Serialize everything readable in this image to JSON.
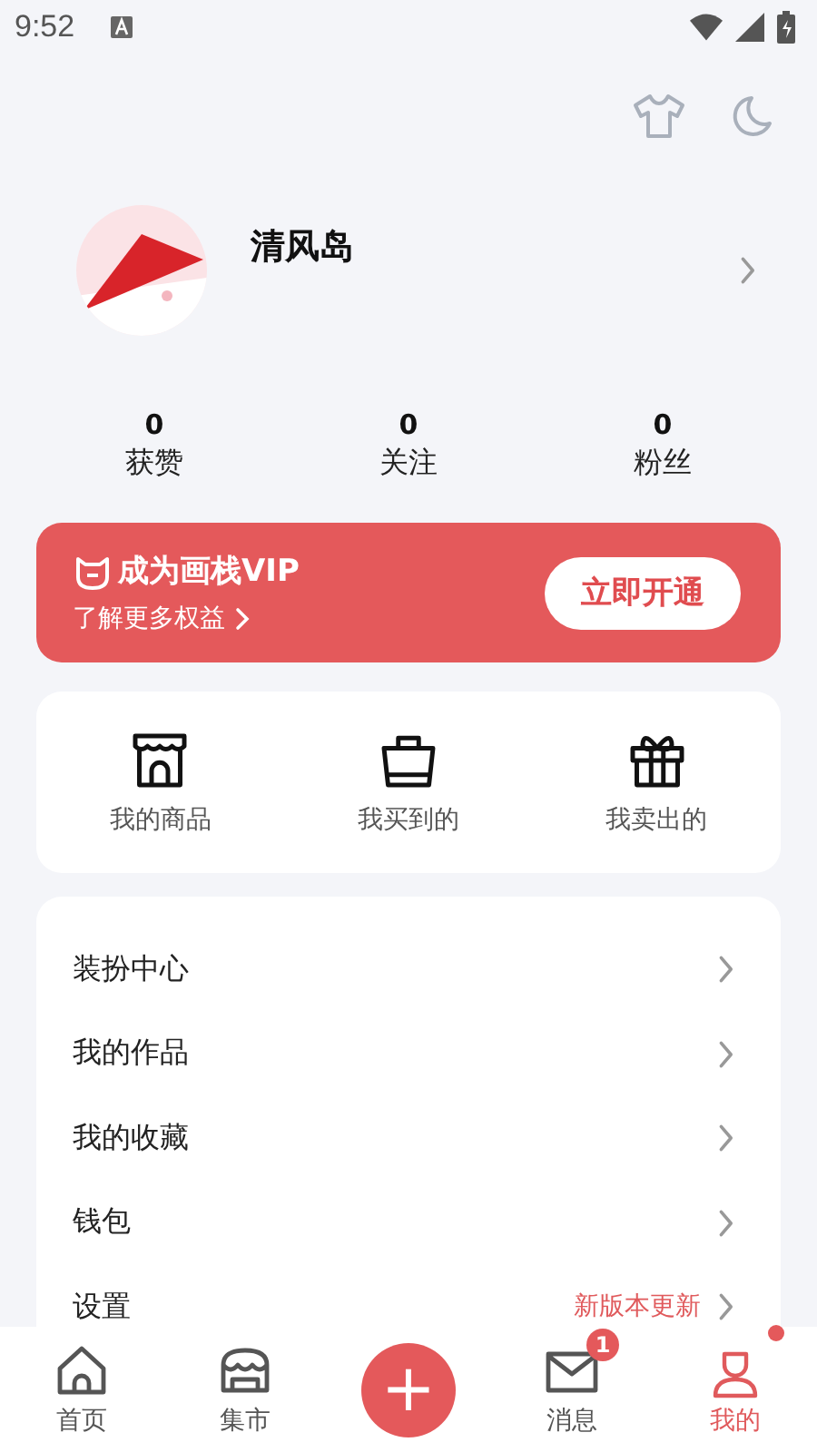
{
  "status_bar": {
    "time": "9:52"
  },
  "profile": {
    "name": "清风岛"
  },
  "stats": [
    {
      "value": "0",
      "label": "获赞"
    },
    {
      "value": "0",
      "label": "关注"
    },
    {
      "value": "0",
      "label": "粉丝"
    }
  ],
  "vip": {
    "title": "成为画栈VIP",
    "subtitle": "了解更多权益",
    "button": "立即开通"
  },
  "shortcuts": [
    {
      "label": "我的商品"
    },
    {
      "label": "我买到的"
    },
    {
      "label": "我卖出的"
    }
  ],
  "menu": [
    {
      "label": "装扮中心"
    },
    {
      "label": "我的作品"
    },
    {
      "label": "我的收藏"
    },
    {
      "label": "钱包"
    },
    {
      "label": "设置",
      "note": "新版本更新"
    }
  ],
  "tabs": [
    {
      "kind": "tab",
      "label": "首页",
      "selected": false
    },
    {
      "kind": "tab",
      "label": "集市",
      "selected": false
    },
    {
      "kind": "add",
      "label": "+",
      "selected": false
    },
    {
      "kind": "tab",
      "label": "消息",
      "selected": false,
      "badge": "1"
    },
    {
      "kind": "tab",
      "label": "我的",
      "selected": true,
      "dot": true
    }
  ]
}
